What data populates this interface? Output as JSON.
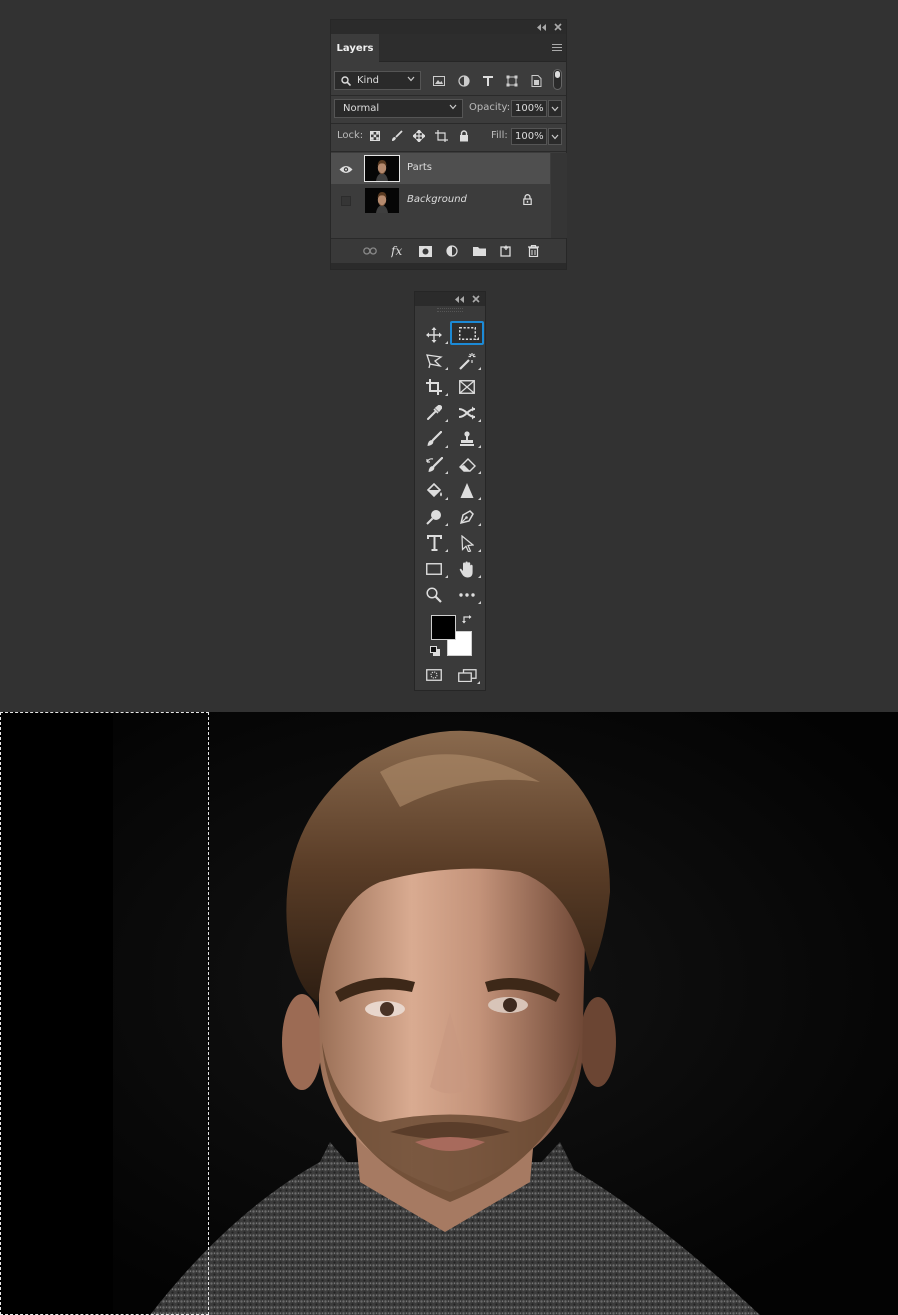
{
  "layers_panel": {
    "tab_title": "Layers",
    "filter": {
      "kind_label": "Kind",
      "filter_icons": [
        "image-filter-icon",
        "adjustment-filter-icon",
        "type-filter-icon",
        "shape-filter-icon",
        "smart-object-filter-icon"
      ]
    },
    "blend_mode": "Normal",
    "opacity_label": "Opacity:",
    "opacity_value": "100%",
    "lock_label": "Lock:",
    "lock_icons": [
      "lock-transparent-icon",
      "lock-image-icon",
      "lock-position-icon",
      "lock-artboard-icon",
      "lock-all-icon"
    ],
    "fill_label": "Fill:",
    "fill_value": "100%",
    "layers": [
      {
        "name": "Parts",
        "visible": true,
        "selected": true,
        "locked": false
      },
      {
        "name": "Background",
        "visible": false,
        "selected": false,
        "locked": true
      }
    ],
    "bottom_icons": [
      "link-layers-icon",
      "fx-icon",
      "add-mask-icon",
      "adjustment-layer-icon",
      "new-group-icon",
      "new-layer-icon",
      "delete-layer-icon"
    ]
  },
  "toolbar": {
    "tools": [
      [
        "move-tool",
        "rectangular-marquee-tool"
      ],
      [
        "polygonal-lasso-tool",
        "magic-wand-tool"
      ],
      [
        "crop-tool",
        "frame-tool"
      ],
      [
        "eyedropper-tool",
        "healing-brush-tool"
      ],
      [
        "brush-tool",
        "clone-stamp-tool"
      ],
      [
        "history-brush-tool",
        "eraser-tool"
      ],
      [
        "paint-bucket-tool",
        "blur-tool"
      ],
      [
        "dodge-tool",
        "pen-tool"
      ],
      [
        "type-tool",
        "path-selection-tool"
      ],
      [
        "rectangle-tool",
        "hand-tool"
      ],
      [
        "zoom-tool",
        "more-tools"
      ]
    ],
    "active_tool": "rectangular-marquee-tool",
    "foreground_color": "#000000",
    "background_color": "#ffffff"
  },
  "colors": {
    "ui_background": "#323232",
    "panel": "#3c3c3c",
    "selected_layer": "#4f4f4f",
    "accent": "#1c8ad6"
  }
}
